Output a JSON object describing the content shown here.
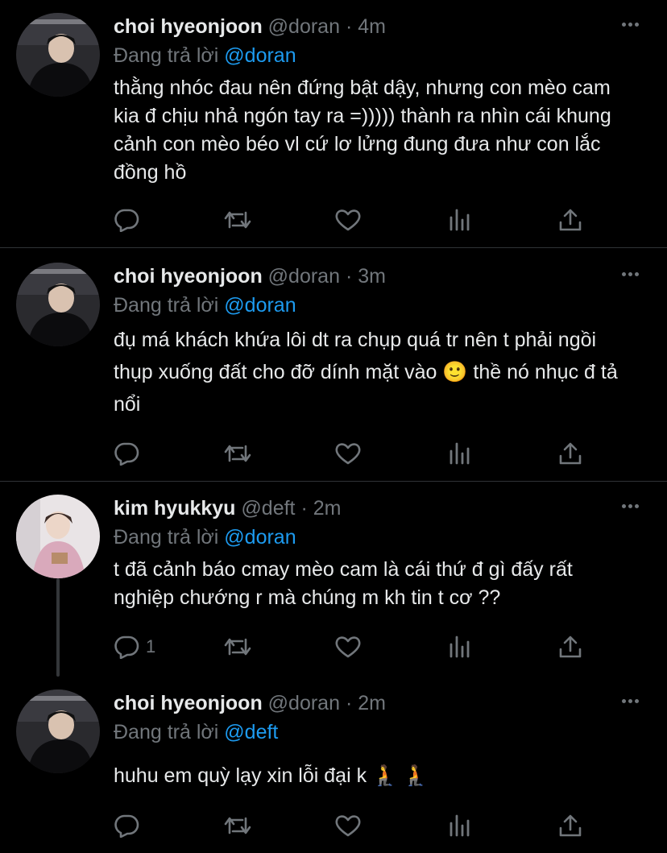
{
  "colors": {
    "background": "#000000",
    "text": "#e7e9ea",
    "muted": "#71767b",
    "accent": "#1d9bf0",
    "divider": "#2f3336"
  },
  "icons": {
    "reply": "speech-bubble-icon",
    "retweet": "retweet-arrows-icon",
    "like": "heart-icon",
    "views": "bar-chart-icon",
    "share": "upload-arrow-icon",
    "more": "three-dots-icon"
  },
  "tweets": [
    {
      "name": "choi hyeonjoon",
      "handle": "@doran",
      "separator": "·",
      "time": "4m",
      "reply_prefix": "Đang trả lời",
      "reply_to": "@doran",
      "text": "thằng nhóc đau nên đứng bật dậy, nhưng con mèo cam kia đ chịu nhả ngón tay ra =))))) thành ra nhìn cái khung cảnh con mèo béo vl cứ lơ lửng đung đưa như con lắc đồng hồ",
      "reply_count": ""
    },
    {
      "name": "choi hyeonjoon",
      "handle": "@doran",
      "separator": "·",
      "time": "3m",
      "reply_prefix": "Đang trả lời",
      "reply_to": "@doran",
      "text": "đụ má khách khứa lôi dt ra chụp quá tr nên t phải ngồi thụp xuống đất cho đỡ dính mặt vào 🙂  thề nó nhục đ tả nổi",
      "reply_count": ""
    },
    {
      "name": "kim hyukkyu",
      "handle": "@deft",
      "separator": "·",
      "time": "2m",
      "reply_prefix": "Đang trả lời",
      "reply_to": "@doran",
      "text": "t đã cảnh báo cmay mèo cam là cái thứ đ gì đấy rất nghiệp chướng r mà chúng m kh tin t cơ ??",
      "reply_count": "1"
    },
    {
      "name": "choi hyeonjoon",
      "handle": "@doran",
      "separator": "·",
      "time": "2m",
      "reply_prefix": "Đang trả lời",
      "reply_to": "@deft",
      "text": "huhu em quỳ lạy xin lỗi đại k 🧎 🧎",
      "reply_count": ""
    }
  ]
}
